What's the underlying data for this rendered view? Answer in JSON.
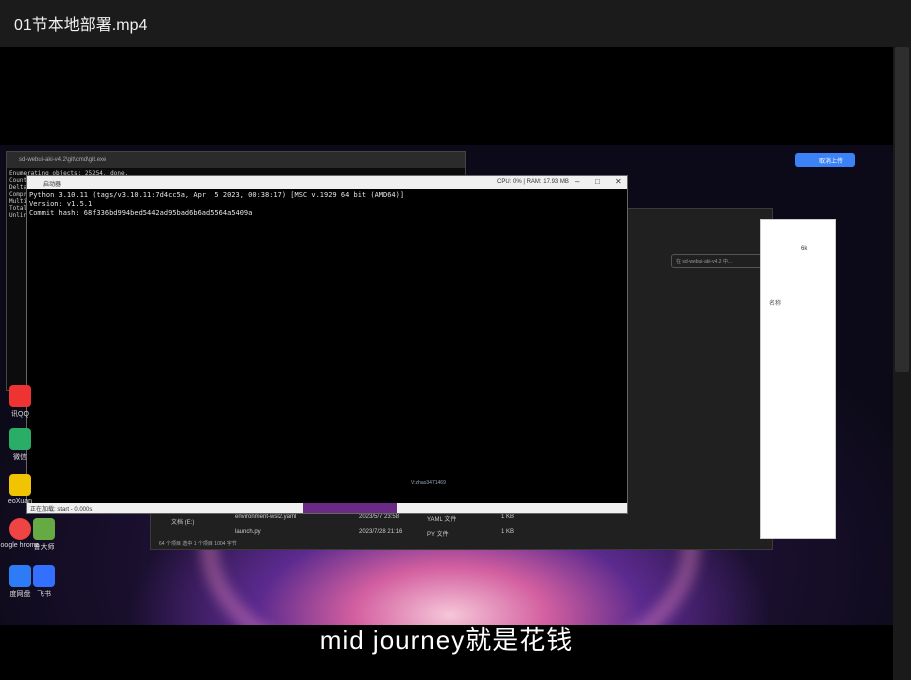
{
  "player": {
    "title": "01节本地部署.mp4"
  },
  "subtitle": "mid  journey就是花钱",
  "desktop": {
    "icons": [
      {
        "label": "讯QQ",
        "color": "#e33"
      },
      {
        "label": "微信",
        "color": "#2aae67"
      },
      {
        "label": "eoXuan",
        "color": "#f0c400"
      },
      {
        "label": "oogle hrome",
        "color": "#e44"
      },
      {
        "label": "鲁大师",
        "color": "#6a4"
      },
      {
        "label": "度网盘",
        "color": "#2d7cf6"
      },
      {
        "label": "飞书",
        "color": "#3370ff"
      }
    ],
    "baidu_button": "取消上传"
  },
  "cmd_back": {
    "title": "sd-webui-aki-v4.2\\git\\cmd\\git.exe",
    "lines": [
      "Enumerating objects: 25254, done.",
      "Counting",
      "Delta",
      "Compre",
      "Multip",
      "Total",
      "Unlink"
    ]
  },
  "explorer": {
    "address": "在 sd-webui-aki-v4.2 中...",
    "sidebar_item": "文档 (E:)",
    "rows": [
      {
        "name": "environment-wsl2.yaml",
        "date": "2023/5/7 23:58",
        "type": "YAML 文件",
        "size": "1 KB"
      },
      {
        "name": "launch.py",
        "date": "2023/7/28 21:16",
        "type": "PY 文件",
        "size": "1 KB"
      }
    ],
    "status": "64 个项目   选中 1 个项目  1004 字节"
  },
  "panel": {
    "label": "名称",
    "badge": "6k"
  },
  "console": {
    "title": "启动器",
    "stats": "CPU: 0% | RAM: 17.93 MB",
    "lines": "Python 3.10.11 (tags/v3.10.11:7d4cc5a, Apr  5 2023, 00:38:17) [MSC v.1929 64 bit (AMD64)]\nVersion: v1.5.1\nCommit hash: 68f336bd994bed5442ad95bad6b6ad5564a5409a",
    "loading": "正在加载: start - 0.000s",
    "watermark": "V:zhao3471469"
  }
}
